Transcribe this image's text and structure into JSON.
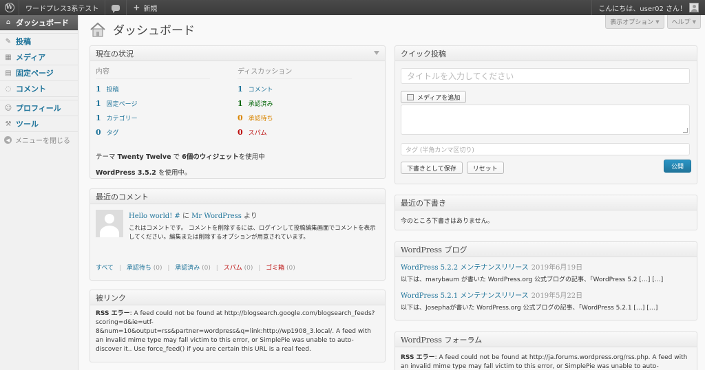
{
  "adminbar": {
    "logo_icon": "wordpress-logo-icon",
    "site_name": "ワードプレス3系テスト",
    "comments_icon": "comment-bubble-icon",
    "new_label": "新規",
    "greeting": "こんにちは、user02 さん！"
  },
  "sidebar": {
    "items": [
      {
        "label": "ダッシュボード",
        "icon": "house-icon"
      },
      {
        "label": "投稿",
        "icon": "pin-icon"
      },
      {
        "label": "メディア",
        "icon": "media-icon"
      },
      {
        "label": "固定ページ",
        "icon": "page-icon"
      },
      {
        "label": "コメント",
        "icon": "comment-icon"
      },
      {
        "label": "プロフィール",
        "icon": "users-icon"
      },
      {
        "label": "ツール",
        "icon": "tools-icon"
      },
      {
        "label": "メニューを閉じる",
        "icon": "collapse-icon"
      }
    ]
  },
  "header": {
    "title": "ダッシュボード",
    "screen_options": "表示オプション",
    "help": "ヘルプ"
  },
  "right_now": {
    "title": "現在の状況",
    "content_head": "内容",
    "discussion_head": "ディスカッション",
    "content": [
      {
        "num": "1",
        "label": "投稿"
      },
      {
        "num": "1",
        "label": "固定ページ"
      },
      {
        "num": "1",
        "label": "カテゴリー"
      },
      {
        "num": "0",
        "label": "タグ"
      }
    ],
    "discussion": [
      {
        "num": "1",
        "label": "コメント"
      },
      {
        "num": "1",
        "label": "承認済み"
      },
      {
        "num": "0",
        "label": "承認待ち"
      },
      {
        "num": "0",
        "label": "スパム"
      }
    ],
    "theme_prefix": "テーマ",
    "theme_name": "Twenty Twelve",
    "theme_mid": "で",
    "widgets": "6個のウィジェット",
    "theme_suffix": "を使用中",
    "version": "WordPress 3.5.2",
    "version_suffix": "を使用中。"
  },
  "recent_comments": {
    "title": "最近のコメント",
    "post_link": "Hello world! #",
    "connector": "に",
    "author": "Mr WordPress",
    "from": "より",
    "text": "これはコメントです。 コメントを削除するには、ログインして投稿編集画面でコメントを表示してください。編集または削除するオプションが用意されています。",
    "links": [
      {
        "label": "すべて",
        "count": ""
      },
      {
        "label": "承認待ち",
        "count": "(0)"
      },
      {
        "label": "承認済み",
        "count": "(0)"
      },
      {
        "label": "スパム",
        "count": "(0)"
      },
      {
        "label": "ゴミ箱",
        "count": "(0)"
      }
    ]
  },
  "incoming_links": {
    "title": "被リンク",
    "error_label": "RSS エラー",
    "error_text": ": A feed could not be found at http://blogsearch.google.com/blogsearch_feeds?scoring=d&ie=utf-8&num=10&output=rss&partner=wordpress&q=link:http://wp1908_3.local/. A feed with an invalid mime type may fall victim to this error, or SimplePie was unable to auto-discover it.. Use force_feed() if you are certain this URL is a real feed."
  },
  "quick_press": {
    "title": "クイック投稿",
    "title_placeholder": "タイトルを入力してください",
    "add_media": "メディアを追加",
    "tags_placeholder": "タグ (半角カンマ区切り)",
    "save_draft": "下書きとして保存",
    "reset": "リセット",
    "publish": "公開"
  },
  "recent_drafts": {
    "title": "最近の下書き",
    "empty": "今のところ下書きはありません。"
  },
  "wp_blog": {
    "title": "WordPress ブログ",
    "items": [
      {
        "title": "WordPress 5.2.2 メンテナンスリリース",
        "date": "2019年6月19日",
        "excerpt": "以下は、marybaum が書いた WordPress.org 公式ブログの記事、「WordPress 5.2 […] […]"
      },
      {
        "title": "WordPress 5.2.1 メンテナンスリリース",
        "date": "2019年5月22日",
        "excerpt": "以下は、Josephaが書いた WordPress.org 公式ブログの記事、「WordPress 5.2.1 […] […]"
      }
    ]
  },
  "wp_forum": {
    "title": "WordPress フォーラム",
    "error_label": "RSS エラー",
    "error_text": ": A feed could not be found at http://ja.forums.wordpress.org/rss.php. A feed with an invalid mime type may fall victim to this error, or SimplePie was unable to auto-"
  },
  "colors": {
    "link": "#21759b",
    "approved": "#006505",
    "pending": "#d98500",
    "spam": "#bc0b0b",
    "adminbar": "#464646"
  }
}
